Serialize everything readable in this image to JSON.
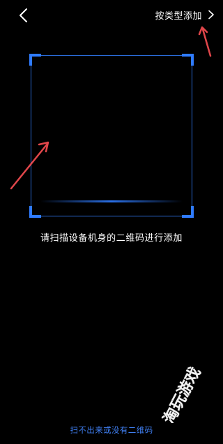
{
  "header": {
    "back_icon": "chevron-left-icon",
    "type_add_label": "按类型添加",
    "type_add_icon": "chevron-right-icon"
  },
  "scanner": {
    "hint": "请扫描设备机身的二维码进行添加",
    "frame_color": "#2f7bff"
  },
  "footer": {
    "no_qr_link": "扫不出来或没有二维码",
    "link_color": "#3f7ef0"
  },
  "watermark": {
    "text": "淘玩游戏"
  },
  "annotations": {
    "arrow_color": "#e0464a"
  }
}
